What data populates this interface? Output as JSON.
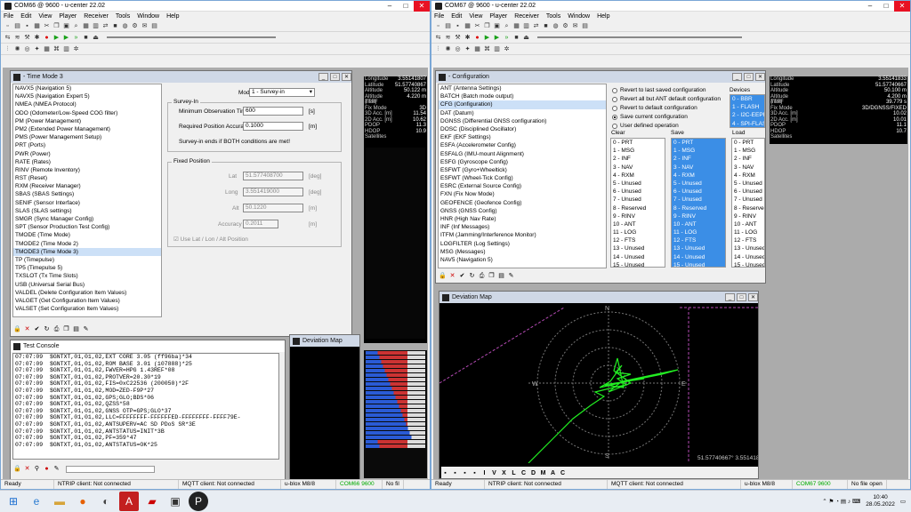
{
  "left_app": {
    "title": "COM66 @ 9600 - u-center 22.02",
    "menu": [
      "File",
      "Edit",
      "View",
      "Player",
      "Receiver",
      "Tools",
      "Window",
      "Help"
    ],
    "status": {
      "ready": "Ready",
      "ntrip": "NTRIP client: Not connected",
      "mqtt": "MQTT client: Not connected",
      "device": "u-blox M8/8",
      "port": "COM66 9600",
      "file": "No fil"
    }
  },
  "right_app": {
    "title": "COM67 @ 9600 - u-center 22.02",
    "menu": [
      "File",
      "Edit",
      "View",
      "Player",
      "Receiver",
      "Tools",
      "Window",
      "Help"
    ],
    "status": {
      "ready": "Ready",
      "ntrip": "NTRIP client: Not connected",
      "mqtt": "MQTT client: Not connected",
      "device": "u-blox M8/8",
      "port": "COM67 9600",
      "file": "No file open"
    }
  },
  "timemode_window": {
    "title": "- Time Mode 3",
    "items": [
      "NAVX5 (Navigation 5)",
      "NAVX5 (Navigation Expert 5)",
      "NMEA (NMEA Protocol)",
      "ODO (Odometer/Low-Speed COG filter)",
      "PM (Power Management)",
      "PM2 (Extended Power Management)",
      "PMS (Power Management Setup)",
      "PRT (Ports)",
      "PWR (Power)",
      "RATE (Rates)",
      "RINV (Remote Inventory)",
      "RST (Reset)",
      "RXM (Receiver Manager)",
      "SBAS (SBAS Settings)",
      "SENIF (Sensor Interface)",
      "SLAS (SLAS settings)",
      "SMGR (Sync Manager Config)",
      "SPT (Sensor Production Test Config)",
      "TMODE (Time Mode)",
      "TMODE2 (Time Mode 2)",
      "TMODE3 (Time Mode 3)",
      "TP (Timepulse)",
      "TP5 (Timepulse 5)",
      "TXSLOT (Tx Time Slots)",
      "USB (Universal Serial Bus)",
      "VALDEL (Delete Configuration Item Values)",
      "VALGET (Get Configuration Item Values)",
      "VALSET (Set Configuration Item Values)"
    ],
    "selected": "TMODE3 (Time Mode 3)",
    "mode_label": "Mode",
    "mode_value": "1 - Survey-in",
    "surveyin_group": "Survey-In",
    "min_obs_label": "Minimum Observation Time",
    "min_obs_value": "600",
    "min_obs_unit": "[s]",
    "req_acc_label": "Required Position Accuracy",
    "req_acc_value": "0.1000",
    "req_acc_unit": "[m]",
    "survey_note": "Survey-in ends if BOTH conditions are met!",
    "fixed_group": "Fixed Position",
    "lat_label": "Lat",
    "lat_value": "51.577408700",
    "lat_unit": "[deg]",
    "long_label": "Long",
    "long_value": "3.551419000",
    "long_unit": "[deg]",
    "alt_label": "Alt",
    "alt_value": "50.1220",
    "alt_unit": "[m]",
    "acc_label": "Accuracy",
    "acc_value": "0.2011",
    "acc_unit": "[m]",
    "use_lla": "Use Lat / Lon / Alt Position"
  },
  "left_info": {
    "rows": [
      [
        "Longitude",
        "3.55141807"
      ],
      [
        "Latitude",
        "51.57740867"
      ],
      [
        "Altitude",
        "50.122 m"
      ],
      [
        "Altitude (msl)",
        "4.220 m"
      ],
      [
        "TTFF",
        ""
      ],
      [
        "Fix Mode",
        "3D"
      ],
      [
        "3D Acc. [m]",
        "11.54"
      ],
      [
        "2D Acc. [m]",
        "10.62"
      ],
      [
        "PDOP",
        "11.3"
      ],
      [
        "HDOP",
        "10.9"
      ],
      [
        "Satellites",
        ""
      ]
    ]
  },
  "test_console": {
    "title": "Test Console",
    "lines": [
      "07:07:09  $GNTXT,01,01,02,EXT CORE 3.05 (ff96ba)*34",
      "07:07:09  $GNTXT,01,01,02,ROM BASE 3.01 (107888)*25",
      "07:07:09  $GNTXT,01,01,02,FWVER=HPG 1.43REF*08",
      "07:07:09  $GNTXT,01,01,02,PROTVER=20.30*19",
      "07:07:09  $GNTXT,01,01,02,FIS=0xC22536 (200050)*2F",
      "07:07:09  $GNTXT,01,01,02,MOD=ZED-F9P*27",
      "07:07:09  $GNTXT,01,01,02,GPS;GLO;BDS*06",
      "07:07:09  $GNTXT,01,01,02,QZSS*58",
      "07:07:09  $GNTXT,01,01,02,GNSS OTP=GPS;GLO*37",
      "07:07:09  $GNTXT,01,01,02,LLC=FFFFFFFF-FFFFFFED-FFFFFFFF-FFFF79E-",
      "07:07:09  $GNTXT,01,01,02,ANTSUPERV=AC SD PDoS SR*3E",
      "07:07:09  $GNTXT,01,01,02,ANTSTATUS=INIT*3B",
      "07:07:09  $GNTXT,01,01,02,PF=359*47",
      "07:07:09  $GNTXT,01,01,02,ANTSTATUS=OK*25"
    ]
  },
  "left_deviation": {
    "title": "Deviation Map"
  },
  "config_window": {
    "title": "- Configuration",
    "items": [
      "ANT (Antenna Settings)",
      "BATCH (Batch mode output)",
      "CFG (Configuration)",
      "DAT (Datum)",
      "DGNSS (Differential GNSS configuration)",
      "DOSC (Disciplined Oscillator)",
      "EKF (EKF Settings)",
      "ESFA (Accelerometer Config)",
      "ESFALG (IMU-mount Alignment)",
      "ESFG (Gyroscope Config)",
      "ESFWT (Gyro+Wheeltick)",
      "ESFWT (Wheel-Tick Config)",
      "ESRC (External Source Config)",
      "FXN (Fix Now Mode)",
      "GEOFENCE (Geofence Config)",
      "GNSS (GNSS Config)",
      "HNR (High Nav Rate)",
      "INF (Inf Messages)",
      "ITFM (Jamming/Interference Monitor)",
      "LOGFILTER (Log Settings)",
      "MSG (Messages)",
      "NAV5 (Navigation 5)"
    ],
    "selected": "CFG (Configuration)",
    "options": [
      "Revert to last saved configuration",
      "Revert all but ANT default configuration",
      "Revert to default configuration",
      "Save current configuration",
      "User defined operation"
    ],
    "selected_option": "Save current configuration",
    "devices_label": "Devices",
    "devices": [
      "0 - BBR",
      "1 - FLASH",
      "2 - I2C-EEPROM",
      "4 - SPI-FLASH"
    ],
    "clear_label": "Clear",
    "save_label": "Save",
    "load_label": "Load",
    "sections": [
      "0 - PRT",
      "1 - MSG",
      "2 - INF",
      "3 - NAV",
      "4 - RXM",
      "5 - Unused",
      "6 - Unused",
      "7 - Unused",
      "8 - Reserved",
      "9 - RINV",
      "10 - ANT",
      "11 - LOG",
      "12 - FTS",
      "13 - Unused",
      "14 - Unused",
      "15 - Unused"
    ]
  },
  "right_info": {
    "rows": [
      [
        "Longitude",
        "3.55141833"
      ],
      [
        "Latitude",
        "51.57740667"
      ],
      [
        "Altitude",
        "50.100 m"
      ],
      [
        "Altitude (msl)",
        "4.200 m"
      ],
      [
        "TTFF",
        "39.779 s"
      ],
      [
        "Fix Mode",
        "3D/DGNSS/FIXED"
      ],
      [
        "3D Acc. [m]",
        "10.02"
      ],
      [
        "2D Acc. [m]",
        "10.01"
      ],
      [
        "PDOP",
        "11.1"
      ],
      [
        "HDOP",
        "10.7"
      ],
      [
        "Satellites",
        ""
      ]
    ]
  },
  "deviation_map": {
    "title": "Deviation Map",
    "north": "N",
    "south": "S",
    "east": "E",
    "west": "W",
    "coords": "51.57740667° 3.55141833°",
    "toolbar": [
      "I",
      "V",
      "X",
      "L",
      "C",
      "D",
      "M",
      "A",
      "C"
    ]
  },
  "taskbar": {
    "time": "10:40",
    "date": "28.05.2022"
  },
  "colors": {
    "track": "#22ee22",
    "accent": "#3b8ee6"
  }
}
